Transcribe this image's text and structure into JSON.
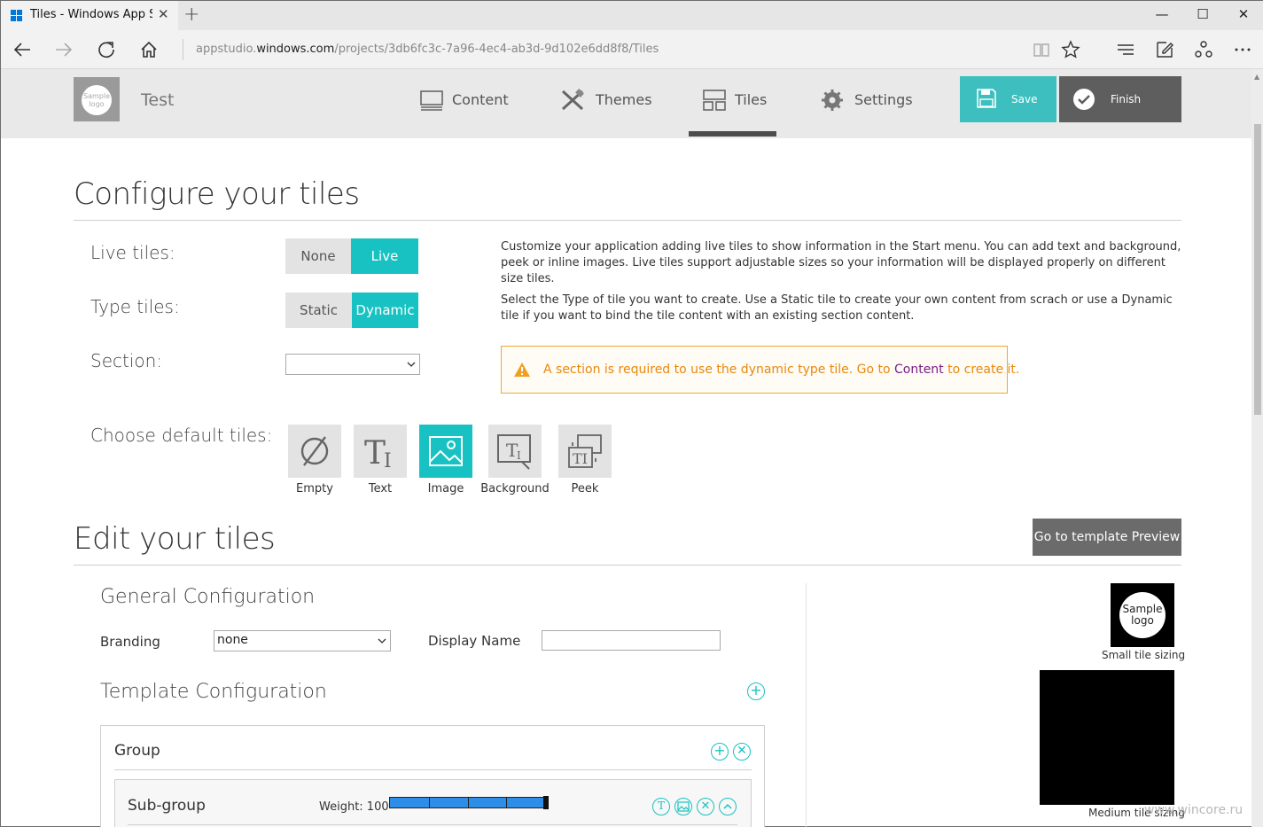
{
  "browser": {
    "tab_title": "Tiles - Windows App Stu",
    "url_prefix": "appstudio.",
    "url_domain": "windows.com",
    "url_path": "/projects/3db6fc3c-7a96-4ec4-ab3d-9d102e6dd8f8/Tiles",
    "new_tab": "+",
    "close_tab": "✕",
    "min": "—",
    "max": "☐",
    "close": "✕"
  },
  "header": {
    "logo_text": "Sample logo",
    "project_name": "Test",
    "nav": [
      {
        "label": "Content"
      },
      {
        "label": "Themes"
      },
      {
        "label": "Tiles"
      },
      {
        "label": "Settings"
      }
    ],
    "save_label": "Save",
    "finish_label": "Finish",
    "accent_color": "#19c2c2"
  },
  "configure": {
    "title": "Configure your tiles",
    "live_tiles_label": "Live tiles:",
    "live_options": [
      "None",
      "Live"
    ],
    "live_selected": "Live",
    "type_tiles_label": "Type tiles:",
    "type_options": [
      "Static",
      "Dynamic"
    ],
    "type_selected": "Dynamic",
    "section_label": "Section:",
    "section_value": "",
    "desc1": "Customize your application adding live tiles to show information in the Start menu. You can add text and background, peek or inline images. Live tiles support adjustable sizes so your information will be displayed properly on different size tiles.",
    "desc2": "Select the Type of tile you want to create. Use a Static tile to create your own content from scrach or use a Dynamic tile if you want to bind the tile content with an existing section content.",
    "warning_pre": "A section is required to use the dynamic type tile. Go to ",
    "warning_link": "Content",
    "warning_post": " to create it.",
    "choose_label": "Choose default tiles:",
    "tiles": [
      {
        "label": "Empty",
        "icon": "empty-icon"
      },
      {
        "label": "Text",
        "icon": "text-icon"
      },
      {
        "label": "Image",
        "icon": "image-icon"
      },
      {
        "label": "Background",
        "icon": "background-icon"
      },
      {
        "label": "Peek",
        "icon": "peek-icon"
      }
    ],
    "tile_selected": "Image"
  },
  "edit": {
    "title": "Edit your tiles",
    "preview_button": "Go to template Preview",
    "general_title": "General Configuration",
    "branding_label": "Branding",
    "branding_value": "none",
    "display_name_label": "Display Name",
    "display_name_value": "",
    "template_title": "Template Configuration",
    "group_label": "Group",
    "subgroup_label": "Sub-group",
    "weight_label": "Weight: 100",
    "weight_value": 100
  },
  "preview": {
    "small_logo": "Sample logo",
    "small_caption": "Small tile sizing",
    "medium_caption": "Medium tile sizing"
  },
  "watermark": "www.wincore.ru"
}
